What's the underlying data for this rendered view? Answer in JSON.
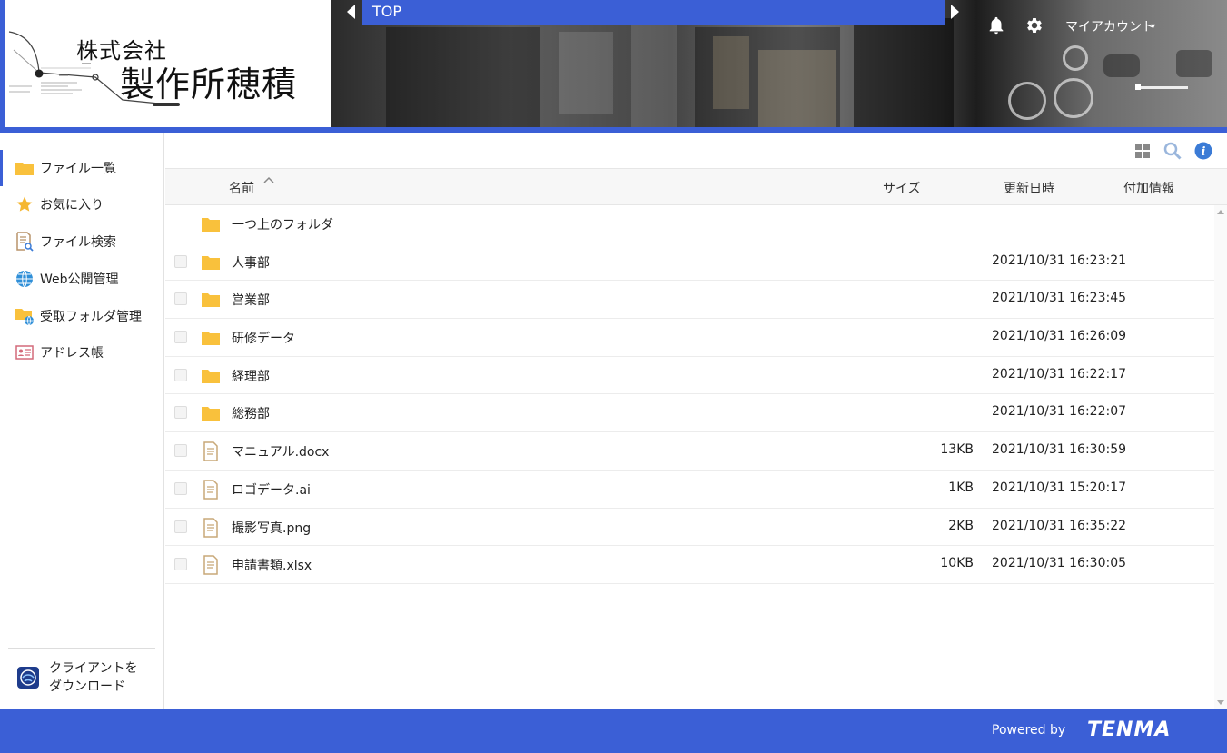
{
  "company": {
    "line1": "株式会社",
    "line2": "製作所穂積"
  },
  "breadcrumb": {
    "current": "TOP"
  },
  "header": {
    "account_label": "マイアカウント",
    "notifications_icon": "bell-icon",
    "settings_icon": "gear-icon"
  },
  "sidebar": {
    "items": [
      {
        "label": "ファイル一覧",
        "icon": "folder-icon",
        "active": true
      },
      {
        "label": "お気に入り",
        "icon": "star-icon"
      },
      {
        "label": "ファイル検索",
        "icon": "file-search-icon"
      },
      {
        "label": "Web公開管理",
        "icon": "globe-icon"
      },
      {
        "label": "受取フォルダ管理",
        "icon": "folder-globe-icon"
      },
      {
        "label": "アドレス帳",
        "icon": "address-card-icon"
      }
    ],
    "client_download": "クライアントを\nダウンロード"
  },
  "toolbar": {
    "grid_view_icon": "grid-icon",
    "search_icon": "search-icon",
    "info_icon": "info-icon"
  },
  "table": {
    "headers": {
      "name": "名前",
      "size": "サイズ",
      "modified": "更新日時",
      "extra": "付加情報"
    },
    "parent_folder": "一つ上のフォルダ",
    "rows": [
      {
        "type": "folder",
        "name": "人事部",
        "size": "",
        "modified": "2021/10/31 16:23:21"
      },
      {
        "type": "folder",
        "name": "営業部",
        "size": "",
        "modified": "2021/10/31 16:23:45"
      },
      {
        "type": "folder",
        "name": "研修データ",
        "size": "",
        "modified": "2021/10/31 16:26:09"
      },
      {
        "type": "folder",
        "name": "経理部",
        "size": "",
        "modified": "2021/10/31 16:22:17"
      },
      {
        "type": "folder",
        "name": "総務部",
        "size": "",
        "modified": "2021/10/31 16:22:07"
      },
      {
        "type": "file",
        "name": "マニュアル.docx",
        "size": "13KB",
        "modified": "2021/10/31 16:30:59"
      },
      {
        "type": "file",
        "name": "ロゴデータ.ai",
        "size": "1KB",
        "modified": "2021/10/31 15:20:17"
      },
      {
        "type": "file",
        "name": "撮影写真.png",
        "size": "2KB",
        "modified": "2021/10/31 16:35:22"
      },
      {
        "type": "file",
        "name": "申請書類.xlsx",
        "size": "10KB",
        "modified": "2021/10/31 16:30:05"
      }
    ]
  },
  "footer": {
    "powered_by": "Powered by",
    "brand": "TENMA"
  },
  "colors": {
    "accent": "#3b5fd6",
    "folder": "#f9c13c",
    "file": "#c8a878"
  }
}
